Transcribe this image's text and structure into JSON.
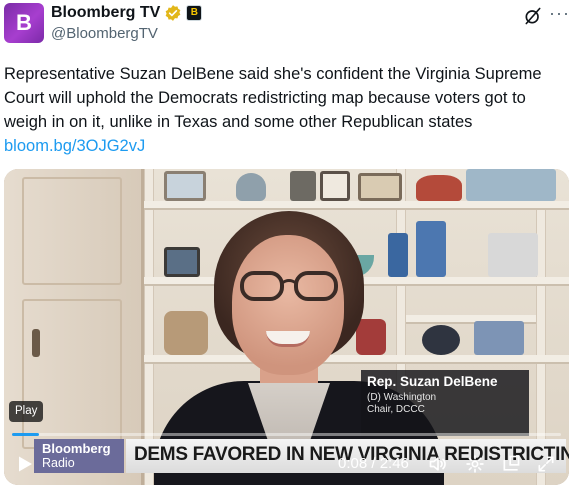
{
  "header": {
    "avatar_letter": "B",
    "display_name": "Bloomberg TV",
    "handle": "@BloombergTV",
    "verified_color": "#e2b719",
    "affiliate_badge_letter": "B"
  },
  "tweet": {
    "text": "Representative Suzan DelBene said she's confident the Virginia Supreme Court will uphold the Democrats redistricting map because voters got to weigh in on it, unlike in Texas and some other Republican states",
    "link": "bloom.bg/3OJG2vJ"
  },
  "video": {
    "play_label": "Play",
    "name_card": {
      "name": "Rep. Suzan DelBene",
      "line1": "(D) Washington",
      "line2": "Chair, DCCC"
    },
    "lower_third": {
      "logo_line1": "Bloomberg",
      "logo_line2": "Radio",
      "headline": "DEMS FAVORED IN NEW VIRGINIA REDISTRICTING MAP"
    },
    "time": "0:08 / 2:46",
    "progress": 0.05
  },
  "colors": {
    "link": "#1d9bf0",
    "accent": "#1d9bf0"
  },
  "icons": [
    "grok-icon",
    "more-icon",
    "play-icon",
    "volume-icon",
    "settings-icon",
    "pip-icon",
    "fullscreen-icon"
  ]
}
